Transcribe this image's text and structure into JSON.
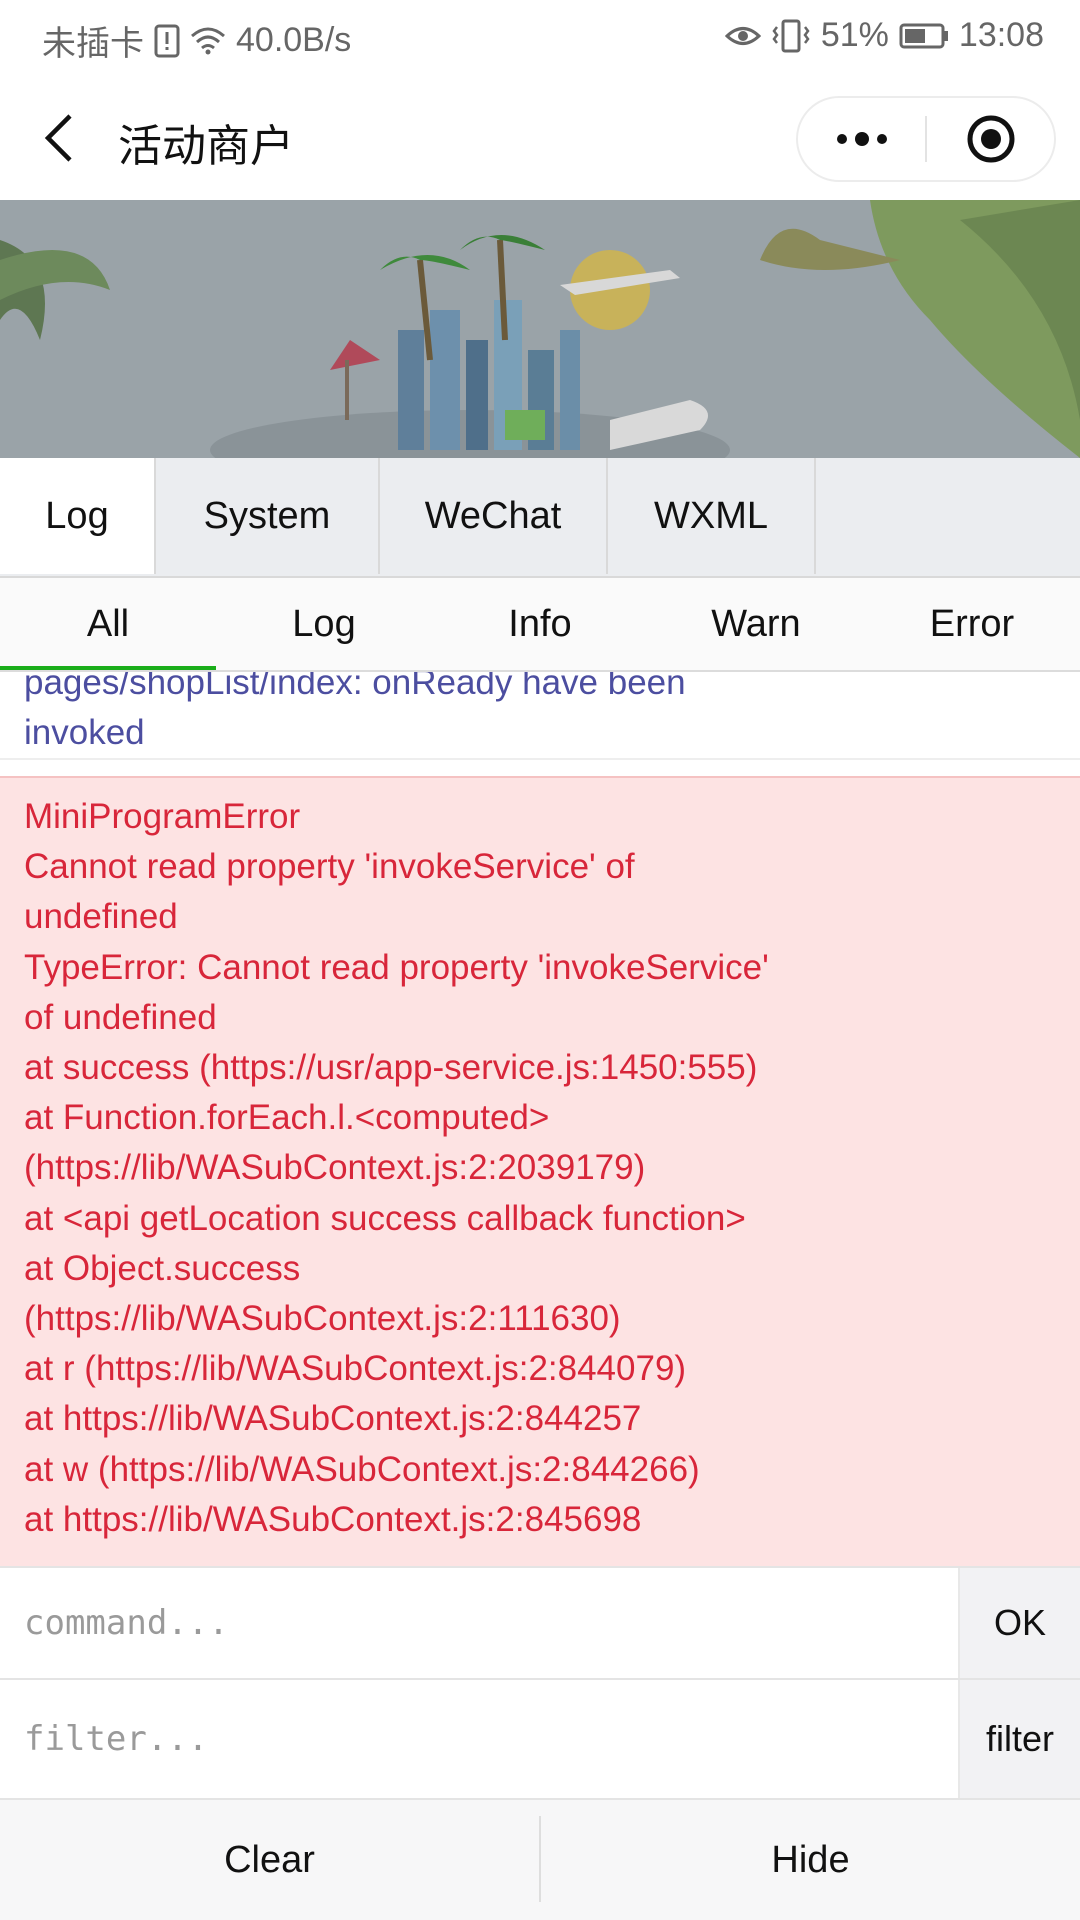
{
  "status_bar": {
    "carrier": "未插卡",
    "speed": "40.0B/s",
    "battery": "51%",
    "time": "13:08"
  },
  "nav": {
    "title": "活动商户"
  },
  "vconsole": {
    "tabs": [
      {
        "label": "Log",
        "active": true
      },
      {
        "label": "System",
        "active": false
      },
      {
        "label": "WeChat",
        "active": false
      },
      {
        "label": "WXML",
        "active": false
      }
    ],
    "subtabs": [
      {
        "label": "All",
        "active": true
      },
      {
        "label": "Log",
        "active": false
      },
      {
        "label": "Info",
        "active": false
      },
      {
        "label": "Warn",
        "active": false
      },
      {
        "label": "Error",
        "active": false
      }
    ],
    "info_log": {
      "lines": [
        "pages/shopList/index: onReady have been",
        "invoked"
      ]
    },
    "error_log": {
      "lines": [
        "MiniProgramError",
        "Cannot read property 'invokeService' of",
        "undefined",
        "TypeError: Cannot read property 'invokeService'",
        "of undefined",
        "at success (https://usr/app-service.js:1450:555)",
        "at Function.forEach.l.<computed>",
        "(https://lib/WASubContext.js:2:2039179)",
        "at <api getLocation success callback function>",
        "at Object.success",
        "(https://lib/WASubContext.js:2:111630)",
        "at r (https://lib/WASubContext.js:2:844079)",
        "at https://lib/WASubContext.js:2:844257",
        "at w (https://lib/WASubContext.js:2:844266)",
        "at https://lib/WASubContext.js:2:845698"
      ]
    },
    "command": {
      "placeholder": "command...",
      "value": "",
      "button": "OK"
    },
    "filter": {
      "placeholder": "filter...",
      "value": "",
      "button": "filter"
    },
    "bottom": {
      "clear": "Clear",
      "hide": "Hide"
    }
  },
  "colors": {
    "error_bg": "#fde3e3",
    "error_text": "#d8263a",
    "info_text": "#4c4ea0",
    "active_subtab_underline": "#1aad19"
  }
}
